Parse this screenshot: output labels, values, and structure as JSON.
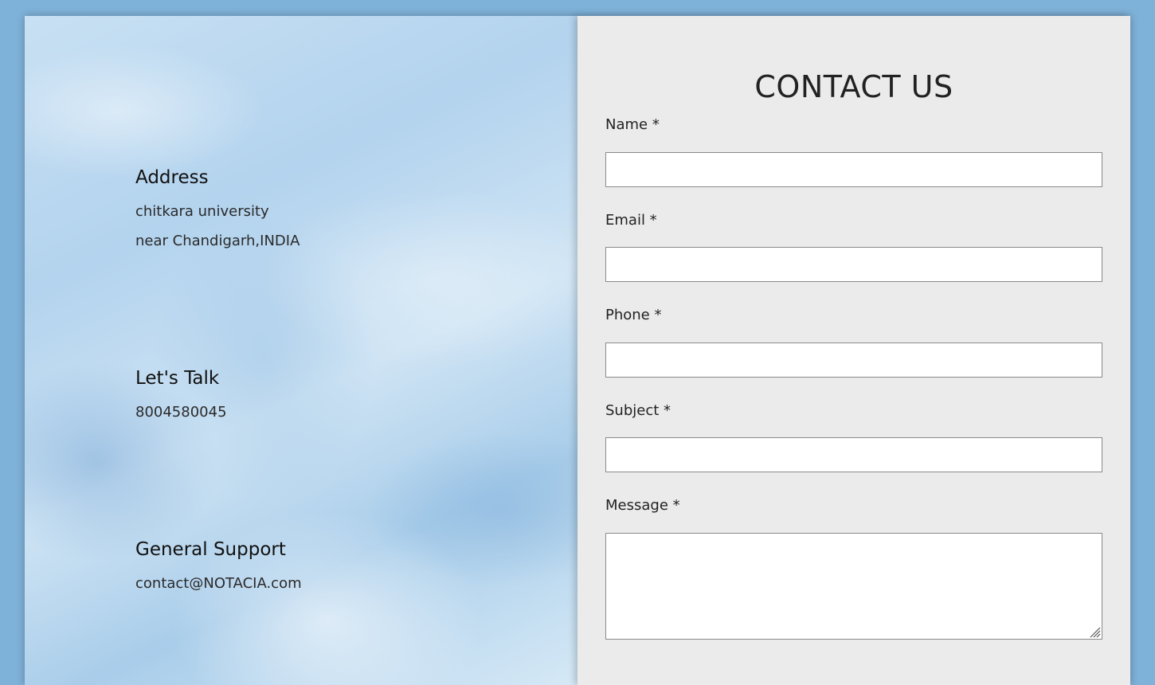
{
  "contact_info": {
    "address": {
      "heading": "Address",
      "line1": "chitkara university",
      "line2": "near Chandigarh,INDIA"
    },
    "talk": {
      "heading": "Let's Talk",
      "phone": "8004580045"
    },
    "support": {
      "heading": "General Support",
      "email": "contact@NOTACIA.com"
    }
  },
  "form": {
    "title": "CONTACT US",
    "name_label": "Name *",
    "name_value": "",
    "email_label": "Email *",
    "email_value": "",
    "phone_label": "Phone *",
    "phone_value": "",
    "subject_label": "Subject *",
    "subject_value": "",
    "message_label": "Message *",
    "message_value": ""
  },
  "colors": {
    "page_background": "#7fb2d9",
    "form_background": "#ecebec",
    "info_panel_tint": "#b3d3ee"
  }
}
